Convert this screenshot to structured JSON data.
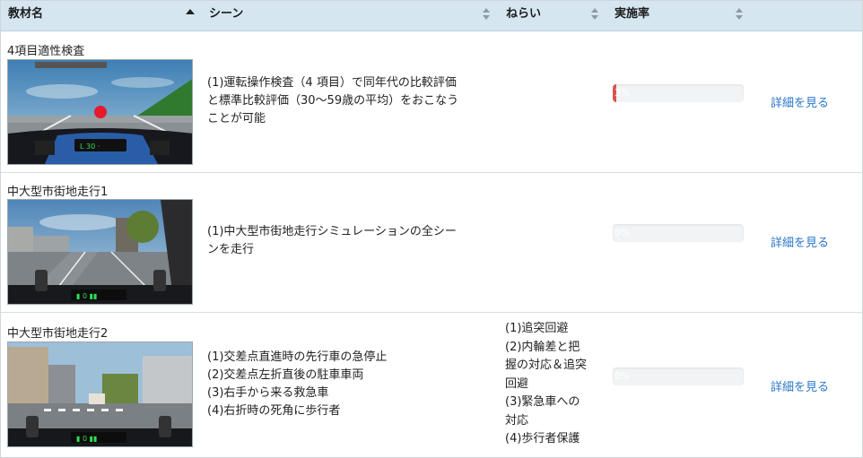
{
  "table": {
    "columns": [
      {
        "label": "教材名"
      },
      {
        "label": "シーン"
      },
      {
        "label": "ねらい"
      },
      {
        "label": "実施率"
      }
    ],
    "rows": [
      {
        "title": "4項目適性検査",
        "scene_lines": [
          "(1)運転操作検査（4 項目）で同年代の比較評価",
          "と標準比較評価（30～59歳の平均）をおこなう",
          "ことが可能"
        ],
        "aim_lines": [],
        "progress_label": "3%",
        "progress": 3,
        "detail": "詳細を見る"
      },
      {
        "title": "中大型市街地走行1",
        "scene_lines": [
          "(1)中大型市街地走行シミュレーションの全シー",
          "ンを走行"
        ],
        "aim_lines": [],
        "progress_label": "0%",
        "progress": 0,
        "detail": "詳細を見る"
      },
      {
        "title": "中大型市街地走行2",
        "scene_lines": [
          "(1)交差点直進時の先行車の急停止",
          "(2)交差点左折直後の駐車車両",
          "(3)右手から来る救急車",
          "(4)右折時の死角に歩行者"
        ],
        "aim_lines": [
          "(1)追突回避",
          "(2)内輪差と把",
          "握の対応＆追突",
          "回避",
          "(3)緊急車への",
          "対応",
          "(4)歩行者保護"
        ],
        "progress_label": "0%",
        "progress": 0,
        "detail": "詳細を見る"
      }
    ]
  },
  "colors": {
    "header_bg": "#d5e6f1",
    "link": "#2a77c9",
    "progress_fill": "#d9534f"
  },
  "icons": {
    "sort_active": "sort-asc-icon",
    "sort_idle": "sort-both-icon"
  }
}
